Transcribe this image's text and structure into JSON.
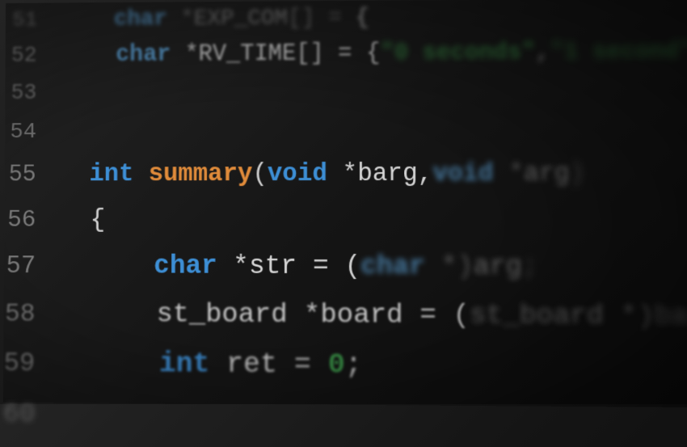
{
  "lines": [
    {
      "no": "51",
      "tokens": [
        {
          "t": "    ",
          "c": "ident"
        },
        {
          "t": "char",
          "c": "kw-type"
        },
        {
          "t": " *",
          "c": "punct-dim"
        },
        {
          "t": "EXP_COM",
          "c": "ident-dim"
        },
        {
          "t": "[] = ",
          "c": "punct-dim"
        },
        {
          "t": "{",
          "c": "brace"
        }
      ]
    },
    {
      "no": "52",
      "tokens": [
        {
          "t": "    ",
          "c": "ident"
        },
        {
          "t": "char",
          "c": "kw-type"
        },
        {
          "t": " *",
          "c": "punct"
        },
        {
          "t": "RV_TIME",
          "c": "ident"
        },
        {
          "t": "[] = ",
          "c": "punct"
        },
        {
          "t": "{",
          "c": "brace"
        },
        {
          "t": "\"0 seconds\"",
          "c": "string right-blur"
        },
        {
          "t": ",",
          "c": "punct right-blur"
        },
        {
          "t": "\"1 second\"",
          "c": "string right-blur-heavy"
        }
      ]
    },
    {
      "no": "53",
      "tokens": []
    },
    {
      "no": "54",
      "tokens": []
    },
    {
      "no": "55",
      "tokens": [
        {
          "t": "  ",
          "c": "ident"
        },
        {
          "t": "int",
          "c": "kw-type-bright"
        },
        {
          "t": " ",
          "c": "ident"
        },
        {
          "t": "summary",
          "c": "funcname"
        },
        {
          "t": "(",
          "c": "punct"
        },
        {
          "t": "void",
          "c": "kw-type-bright"
        },
        {
          "t": " *",
          "c": "punct"
        },
        {
          "t": "barg",
          "c": "ident"
        },
        {
          "t": ",",
          "c": "punct"
        },
        {
          "t": "void",
          "c": "kw-type right-blur"
        },
        {
          "t": " *",
          "c": "punct-dim right-blur"
        },
        {
          "t": "arg",
          "c": "ident-dim right-blur"
        },
        {
          "t": ")",
          "c": "punct-dim right-blur-heavy"
        }
      ]
    },
    {
      "no": "56",
      "tokens": [
        {
          "t": "  ",
          "c": "ident"
        },
        {
          "t": "{",
          "c": "brace"
        }
      ]
    },
    {
      "no": "57",
      "tokens": [
        {
          "t": "      ",
          "c": "ident"
        },
        {
          "t": "char",
          "c": "kw-type-bright"
        },
        {
          "t": " *",
          "c": "punct"
        },
        {
          "t": "str",
          "c": "ident"
        },
        {
          "t": " = (",
          "c": "punct"
        },
        {
          "t": "char",
          "c": "kw-type right-blur"
        },
        {
          "t": " *)",
          "c": "punct-dim right-blur"
        },
        {
          "t": "arg",
          "c": "ident-dim right-blur"
        },
        {
          "t": ";",
          "c": "punct-dim right-blur-heavy"
        }
      ]
    },
    {
      "no": "58",
      "tokens": [
        {
          "t": "      ",
          "c": "ident"
        },
        {
          "t": "st_board",
          "c": "ident"
        },
        {
          "t": " *",
          "c": "punct"
        },
        {
          "t": "board",
          "c": "ident"
        },
        {
          "t": " = (",
          "c": "punct"
        },
        {
          "t": "st_board",
          "c": "ident-dim right-blur"
        },
        {
          "t": " *)",
          "c": "punct-dim right-blur"
        },
        {
          "t": "barg",
          "c": "ident-dim right-blur-heavy"
        },
        {
          "t": ";",
          "c": "punct-dim right-blur-heavy"
        }
      ]
    },
    {
      "no": "59",
      "tokens": [
        {
          "t": "      ",
          "c": "ident"
        },
        {
          "t": "int",
          "c": "kw-type-bright"
        },
        {
          "t": " ",
          "c": "ident"
        },
        {
          "t": "ret",
          "c": "ident"
        },
        {
          "t": " = ",
          "c": "punct"
        },
        {
          "t": "0",
          "c": "number"
        },
        {
          "t": ";",
          "c": "punct"
        }
      ]
    },
    {
      "no": "60",
      "tokens": []
    }
  ]
}
